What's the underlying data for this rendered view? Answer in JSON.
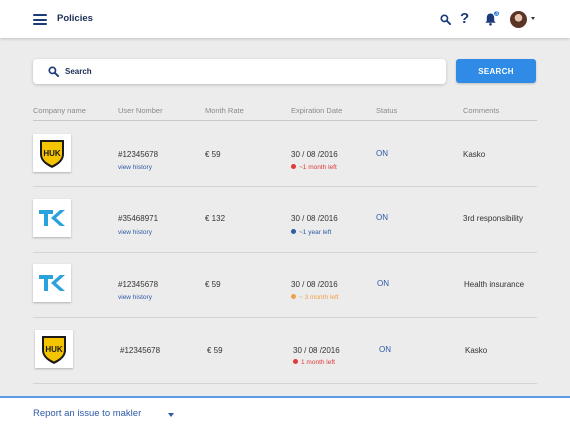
{
  "header": {
    "title": "Policies"
  },
  "search": {
    "placeholder": "Search",
    "button_label": "SEARCH"
  },
  "columns": [
    "Company name",
    "User Nomber",
    "Month Rate",
    "Expiration Date",
    "Status",
    "Comments"
  ],
  "rows": [
    {
      "company": "HUK",
      "logo": "huk-logo",
      "user_number": "#12345678",
      "history_label": "view history",
      "rate": "€ 59",
      "expiration": "30 / 08 /2016",
      "time_left": "~1 month left",
      "time_left_color": "#e03a3a",
      "status": "ON",
      "comment": "Kasko"
    },
    {
      "company": "TK",
      "logo": "tk-logo",
      "user_number": "#35468971",
      "history_label": "view history",
      "rate": "€ 132",
      "expiration": "30 / 08 /2016",
      "time_left": "~1 year left",
      "time_left_color": "#2e5aa6",
      "status": "ON",
      "comment": "3rd responsibility"
    },
    {
      "company": "TK",
      "logo": "tk-logo",
      "user_number": "#12345678",
      "history_label": "view history",
      "rate": "€ 59",
      "expiration": "30 / 08 /2016",
      "time_left": "~ 3 month left",
      "time_left_color": "#f0a04b",
      "status": "ON",
      "comment": "Health insurance"
    },
    {
      "company": "HUK",
      "logo": "huk-logo",
      "user_number": "#12345678",
      "history_label": "",
      "rate": "€ 59",
      "expiration": "30 / 08 /2016",
      "time_left": "1 month left",
      "time_left_color": "#e03a3a",
      "status": "ON",
      "comment": "Kasko"
    }
  ],
  "footer": {
    "report_label": "Report an issue to makler"
  },
  "icons": {
    "menu": "hamburger-icon",
    "search": "search-icon",
    "help": "help-icon",
    "notifications": "bell-icon",
    "avatar": "user-avatar",
    "caret": "chevron-down-icon"
  },
  "notification_count": "3",
  "colors": {
    "accent": "#2f8be6",
    "navy": "#1c3a78",
    "link": "#2e5aa6",
    "warning": "#f0a04b",
    "danger": "#e03a3a"
  }
}
